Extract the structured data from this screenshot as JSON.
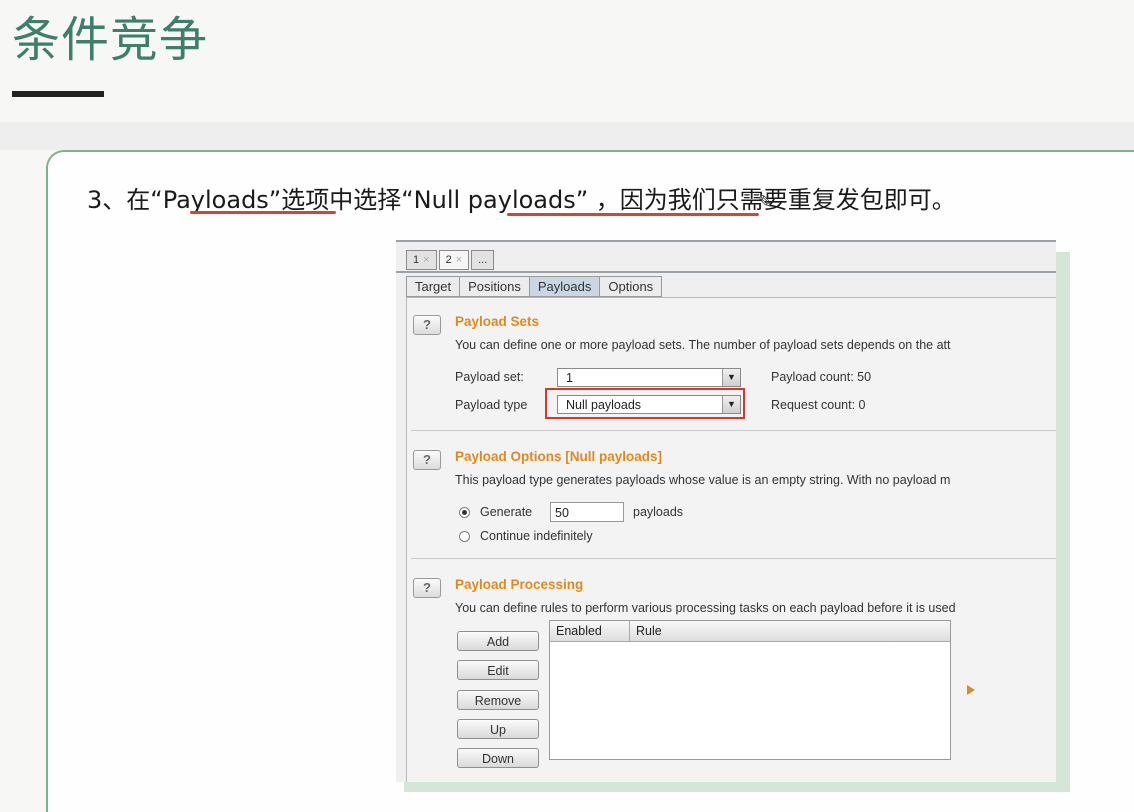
{
  "slide": {
    "title": "条件竞争",
    "instruction": "3、在“Payloads”选项中选择“Null payloads” ，因为我们只需要重复发包即可。"
  },
  "burp": {
    "number_tabs": [
      "1",
      "2",
      "..."
    ],
    "number_tab_close": "×",
    "tabs": [
      "Target",
      "Positions",
      "Payloads",
      "Options"
    ],
    "active_tab": "Payloads",
    "help_label": "?",
    "payload_sets": {
      "title": "Payload Sets",
      "description": "You can define one or more payload sets. The number of payload sets depends on the att",
      "set_label": "Payload set:",
      "set_value": "1",
      "type_label": "Payload type",
      "type_value": "Null payloads",
      "payload_count": "Payload count:  50",
      "request_count": "Request count:  0"
    },
    "payload_options": {
      "title": "Payload Options [Null payloads]",
      "description": "This payload type generates payloads whose value is an empty string. With no payload m",
      "generate_label": "Generate",
      "generate_value": "50",
      "payloads_suffix": "payloads",
      "continue_label": "Continue indefinitely",
      "selected": "generate"
    },
    "payload_processing": {
      "title": "Payload Processing",
      "description": "You can define rules to perform various processing tasks on each payload before it is used",
      "buttons": [
        "Add",
        "Edit",
        "Remove",
        "Up",
        "Down"
      ],
      "columns": [
        "Enabled",
        "Rule"
      ],
      "rows": []
    }
  },
  "colors": {
    "title": "#3d7f6c",
    "section_title": "#e08a1e",
    "highlight": "#d33a2f",
    "underline": "#d64533"
  }
}
